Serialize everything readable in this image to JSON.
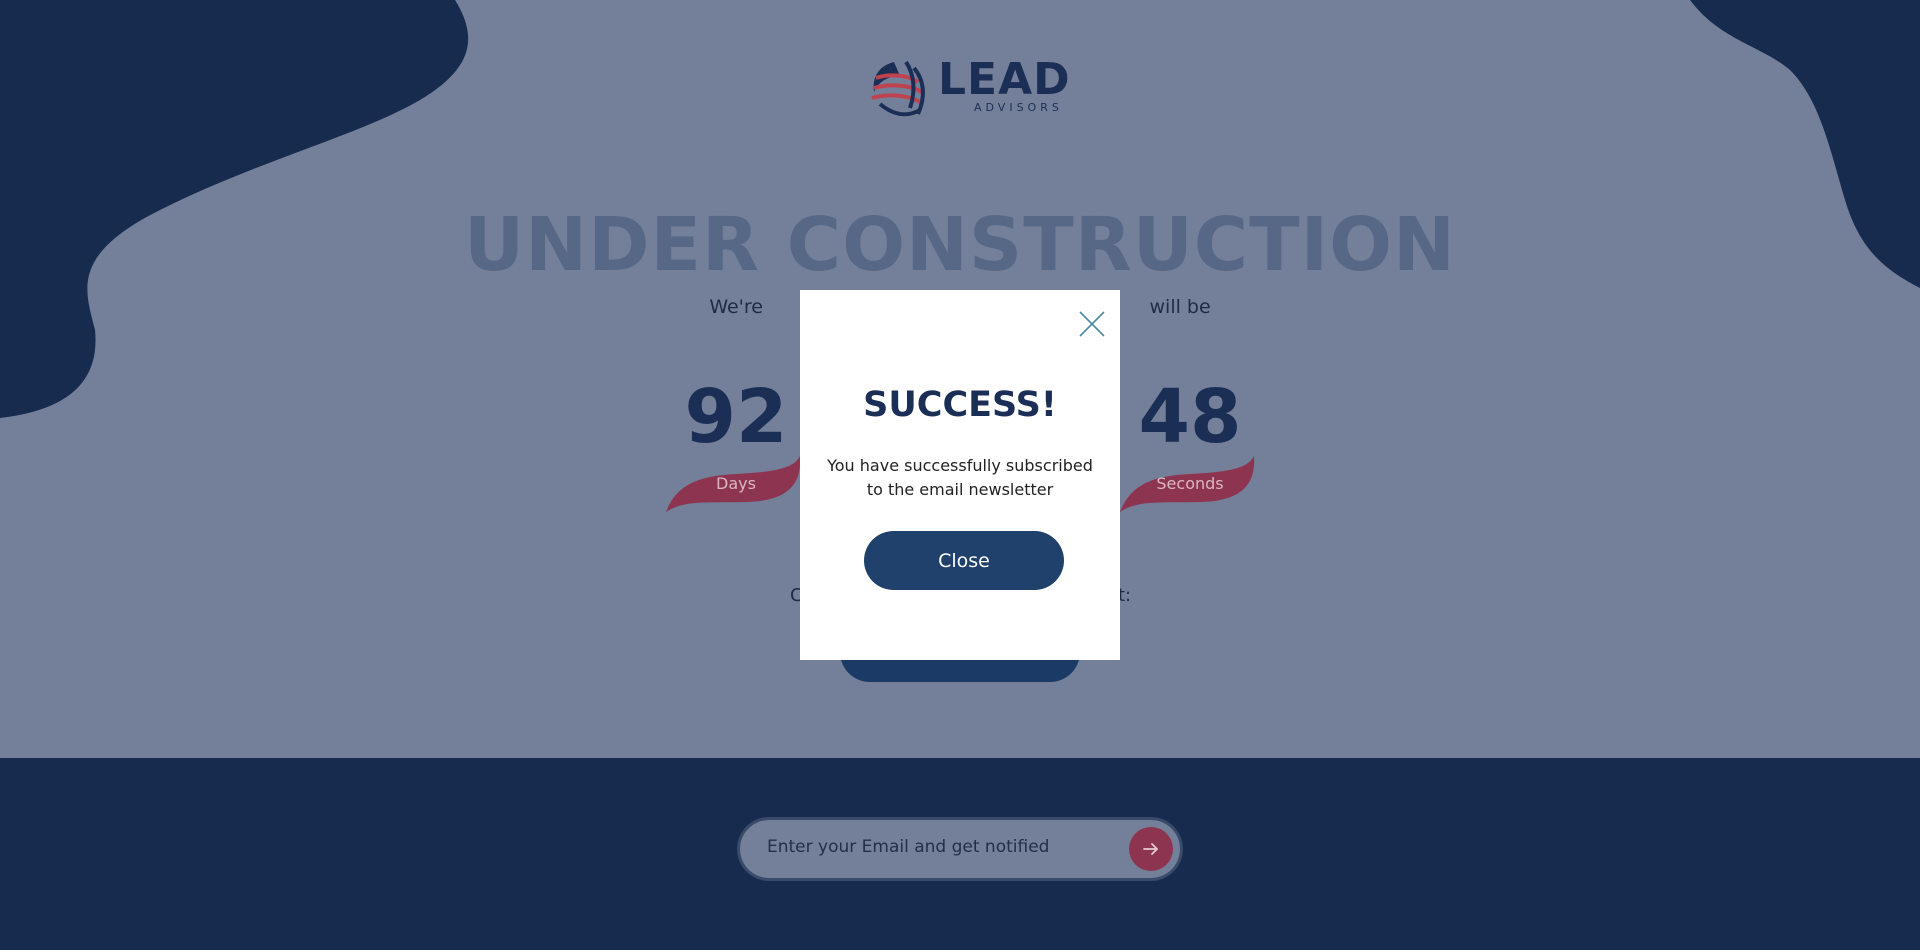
{
  "brand": {
    "name": "LEAD",
    "tagline": "ADVISORS"
  },
  "hero": {
    "headline": "UNDER CONSTRUCTION",
    "subline": "We're                                                                will be"
  },
  "countdown": [
    {
      "value": "92",
      "label": "Days"
    },
    {
      "value": "48",
      "label": "Seconds"
    }
  ],
  "contact": {
    "left_fragment": "C",
    "right_fragment": "t:"
  },
  "newsletter": {
    "placeholder": "Enter your Email and get notified",
    "submit_icon": "arrow-right-icon"
  },
  "modal": {
    "title": "SUCCESS!",
    "message": "You have successfully subscribed to the email newsletter",
    "button": "Close",
    "close_icon": "close-icon"
  },
  "colors": {
    "overlay_bg": "#74809a",
    "dark_navy": "#172b4f",
    "brand_navy": "#1b2e55",
    "button_navy": "#1f416b",
    "accent_red": "#8d3550",
    "modal_bg": "#ffffff"
  }
}
